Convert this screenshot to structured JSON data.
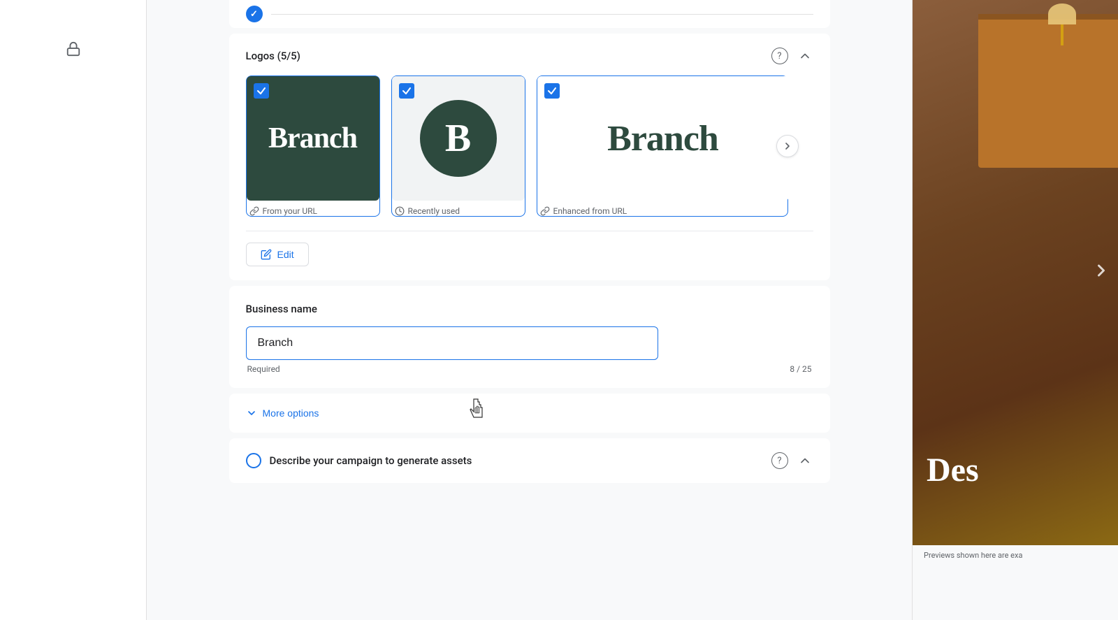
{
  "sidebar": {
    "lock_icon": "🔒"
  },
  "logos_section": {
    "title": "Logos (5/5)",
    "logos": [
      {
        "id": "logo-1",
        "type": "text-on-dark",
        "checked": true,
        "text": "Branch",
        "label": "From your URL",
        "label_icon": "link"
      },
      {
        "id": "logo-2",
        "type": "circle-initial",
        "checked": true,
        "initial": "B",
        "label": "Recently used",
        "label_icon": "clock"
      },
      {
        "id": "logo-3",
        "type": "text-on-light",
        "checked": true,
        "text": "Branch",
        "label": "Enhanced from URL",
        "label_icon": "link"
      }
    ]
  },
  "edit_button": {
    "label": "Edit"
  },
  "business_name_section": {
    "title": "Business name",
    "value": "Branch",
    "required_text": "Required",
    "char_count": "8 / 25"
  },
  "more_options": {
    "label": "More options"
  },
  "describe_section": {
    "title": "Describe your campaign to generate assets"
  },
  "preview": {
    "note": "Previews shown here are exa"
  }
}
